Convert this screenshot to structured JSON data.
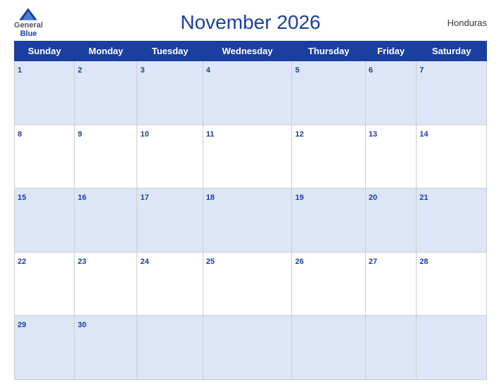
{
  "header": {
    "logo": {
      "general": "General",
      "blue": "Blue"
    },
    "title": "November 2026",
    "country": "Honduras"
  },
  "weekdays": [
    "Sunday",
    "Monday",
    "Tuesday",
    "Wednesday",
    "Thursday",
    "Friday",
    "Saturday"
  ],
  "weeks": [
    [
      {
        "day": 1,
        "empty": false
      },
      {
        "day": 2,
        "empty": false
      },
      {
        "day": 3,
        "empty": false
      },
      {
        "day": 4,
        "empty": false
      },
      {
        "day": 5,
        "empty": false
      },
      {
        "day": 6,
        "empty": false
      },
      {
        "day": 7,
        "empty": false
      }
    ],
    [
      {
        "day": 8,
        "empty": false
      },
      {
        "day": 9,
        "empty": false
      },
      {
        "day": 10,
        "empty": false
      },
      {
        "day": 11,
        "empty": false
      },
      {
        "day": 12,
        "empty": false
      },
      {
        "day": 13,
        "empty": false
      },
      {
        "day": 14,
        "empty": false
      }
    ],
    [
      {
        "day": 15,
        "empty": false
      },
      {
        "day": 16,
        "empty": false
      },
      {
        "day": 17,
        "empty": false
      },
      {
        "day": 18,
        "empty": false
      },
      {
        "day": 19,
        "empty": false
      },
      {
        "day": 20,
        "empty": false
      },
      {
        "day": 21,
        "empty": false
      }
    ],
    [
      {
        "day": 22,
        "empty": false
      },
      {
        "day": 23,
        "empty": false
      },
      {
        "day": 24,
        "empty": false
      },
      {
        "day": 25,
        "empty": false
      },
      {
        "day": 26,
        "empty": false
      },
      {
        "day": 27,
        "empty": false
      },
      {
        "day": 28,
        "empty": false
      }
    ],
    [
      {
        "day": 29,
        "empty": false
      },
      {
        "day": 30,
        "empty": false
      },
      {
        "day": null,
        "empty": true
      },
      {
        "day": null,
        "empty": true
      },
      {
        "day": null,
        "empty": true
      },
      {
        "day": null,
        "empty": true
      },
      {
        "day": null,
        "empty": true
      }
    ]
  ]
}
